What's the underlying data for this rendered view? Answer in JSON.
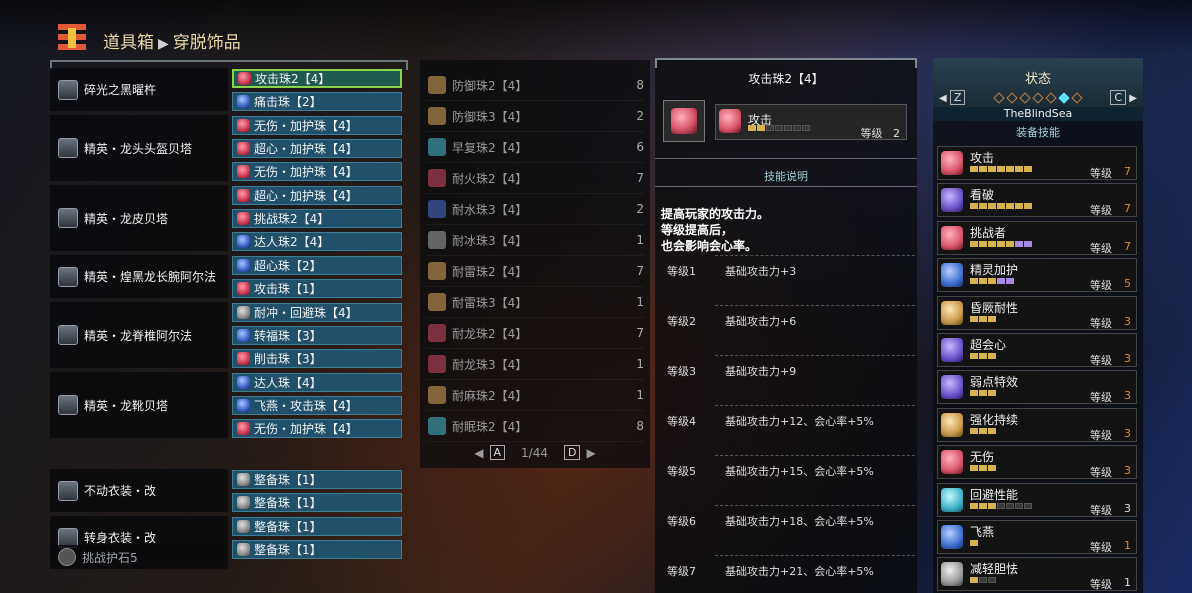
{
  "header": {
    "crumb1": "道具箱",
    "crumb2": "穿脱饰品"
  },
  "equipment": [
    {
      "name": "碎光之黑曜杵",
      "slots": [
        {
          "label": "攻击珠2【4】",
          "color": "red",
          "selected": true
        },
        {
          "label": "痛击珠【2】",
          "color": "blue"
        }
      ]
    },
    {
      "name": "精英・龙头头盔贝塔",
      "slots": [
        {
          "label": "无伤・加护珠【4】",
          "color": "red"
        },
        {
          "label": "超心・加护珠【4】",
          "color": "red"
        },
        {
          "label": "无伤・加护珠【4】",
          "color": "red"
        }
      ]
    },
    {
      "name": "精英・龙皮贝塔",
      "slots": [
        {
          "label": "超心・加护珠【4】",
          "color": "red"
        },
        {
          "label": "挑战珠2【4】",
          "color": "red"
        },
        {
          "label": "达人珠2【4】",
          "color": "blue"
        }
      ]
    },
    {
      "name": "精英・煌黑龙长腕阿尔法",
      "slots": [
        {
          "label": "超心珠【2】",
          "color": "blue"
        },
        {
          "label": "攻击珠【1】",
          "color": "red"
        }
      ]
    },
    {
      "name": "精英・龙脊椎阿尔法",
      "slots": [
        {
          "label": "耐冲・回避珠【4】",
          "color": "gray"
        },
        {
          "label": "转福珠【3】",
          "color": "blue"
        },
        {
          "label": "削击珠【3】",
          "color": "red"
        }
      ]
    },
    {
      "name": "精英・龙靴贝塔",
      "slots": [
        {
          "label": "达人珠【4】",
          "color": "blue"
        },
        {
          "label": "飞燕・攻击珠【4】",
          "color": "blue"
        },
        {
          "label": "无伤・加护珠【4】",
          "color": "red"
        }
      ]
    },
    {
      "name": "不动衣装・改",
      "slots": [
        {
          "label": "整备珠【1】",
          "color": "gray"
        },
        {
          "label": "整备珠【1】",
          "color": "gray"
        }
      ]
    },
    {
      "name": "转身衣装・改",
      "slots": [
        {
          "label": "整备珠【1】",
          "color": "gray"
        },
        {
          "label": "整备珠【1】",
          "color": "gray"
        }
      ]
    }
  ],
  "charm": {
    "name": "挑战护石5"
  },
  "decoration_list": {
    "items": [
      {
        "name": "防御珠2【4】",
        "count": "8",
        "color": "tan"
      },
      {
        "name": "防御珠3【4】",
        "count": "2",
        "color": "tan"
      },
      {
        "name": "早复珠2【4】",
        "count": "6",
        "color": "cyan"
      },
      {
        "name": "耐火珠2【4】",
        "count": "7",
        "color": "red"
      },
      {
        "name": "耐水珠3【4】",
        "count": "2",
        "color": "blue"
      },
      {
        "name": "耐冰珠3【4】",
        "count": "1",
        "color": "gray"
      },
      {
        "name": "耐雷珠2【4】",
        "count": "7",
        "color": "tan"
      },
      {
        "name": "耐雷珠3【4】",
        "count": "1",
        "color": "tan"
      },
      {
        "name": "耐龙珠2【4】",
        "count": "7",
        "color": "red"
      },
      {
        "name": "耐龙珠3【4】",
        "count": "1",
        "color": "red"
      },
      {
        "name": "耐麻珠2【4】",
        "count": "1",
        "color": "tan"
      },
      {
        "name": "耐眠珠2【4】",
        "count": "8",
        "color": "cyan"
      }
    ],
    "pager": {
      "left_key": "A",
      "page": "1/44",
      "right_key": "D"
    }
  },
  "detail": {
    "title": "攻击珠2【4】",
    "skill_name": "攻击",
    "skill_level_label": "等级",
    "skill_level": "2",
    "skill_pips_on": 2,
    "skill_pips_total": 7,
    "section_label": "技能说明",
    "desc1": "提高玩家的攻击力。",
    "desc2": "等级提高后，",
    "desc3": "也会影响会心率。",
    "levels": [
      {
        "lv": "等级1",
        "effect": "基础攻击力+3"
      },
      {
        "lv": "等级2",
        "effect": "基础攻击力+6"
      },
      {
        "lv": "等级3",
        "effect": "基础攻击力+9"
      },
      {
        "lv": "等级4",
        "effect": "基础攻击力+12、会心率+5%"
      },
      {
        "lv": "等级5",
        "effect": "基础攻击力+15、会心率+5%"
      },
      {
        "lv": "等级6",
        "effect": "基础攻击力+18、会心率+5%"
      },
      {
        "lv": "等级7",
        "effect": "基础攻击力+21、会心率+5%"
      }
    ]
  },
  "status": {
    "title": "状态",
    "left_key": "Z",
    "right_key": "C",
    "player": "TheBlindSea",
    "equip_skills_label": "装备技能",
    "level_label": "等级",
    "skills": [
      {
        "name": "攻击",
        "level": "7",
        "on": 7,
        "ext": 0,
        "total": 7,
        "color": "red",
        "max": true
      },
      {
        "name": "看破",
        "level": "7",
        "on": 7,
        "ext": 0,
        "total": 7,
        "color": "purple",
        "max": true
      },
      {
        "name": "挑战者",
        "level": "7",
        "on": 5,
        "ext": 2,
        "total": 7,
        "color": "red",
        "max": true
      },
      {
        "name": "精灵加护",
        "level": "5",
        "on": 3,
        "ext": 2,
        "total": 5,
        "color": "blue",
        "max": true
      },
      {
        "name": "昏厥耐性",
        "level": "3",
        "on": 3,
        "ext": 0,
        "total": 3,
        "color": "tan",
        "max": true
      },
      {
        "name": "超会心",
        "level": "3",
        "on": 3,
        "ext": 0,
        "total": 3,
        "color": "purple",
        "max": true
      },
      {
        "name": "弱点特效",
        "level": "3",
        "on": 3,
        "ext": 0,
        "total": 3,
        "color": "purple",
        "max": true
      },
      {
        "name": "强化持续",
        "level": "3",
        "on": 3,
        "ext": 0,
        "total": 3,
        "color": "tan",
        "max": true
      },
      {
        "name": "无伤",
        "level": "3",
        "on": 3,
        "ext": 0,
        "total": 3,
        "color": "red",
        "max": true
      },
      {
        "name": "回避性能",
        "level": "3",
        "on": 3,
        "ext": 0,
        "total": 7,
        "color": "cyan",
        "max": false
      },
      {
        "name": "飞燕",
        "level": "1",
        "on": 1,
        "ext": 0,
        "total": 1,
        "color": "blue",
        "max": true
      },
      {
        "name": "减轻胆怯",
        "level": "1",
        "on": 1,
        "ext": 0,
        "total": 3,
        "color": "gray",
        "max": false
      }
    ]
  }
}
